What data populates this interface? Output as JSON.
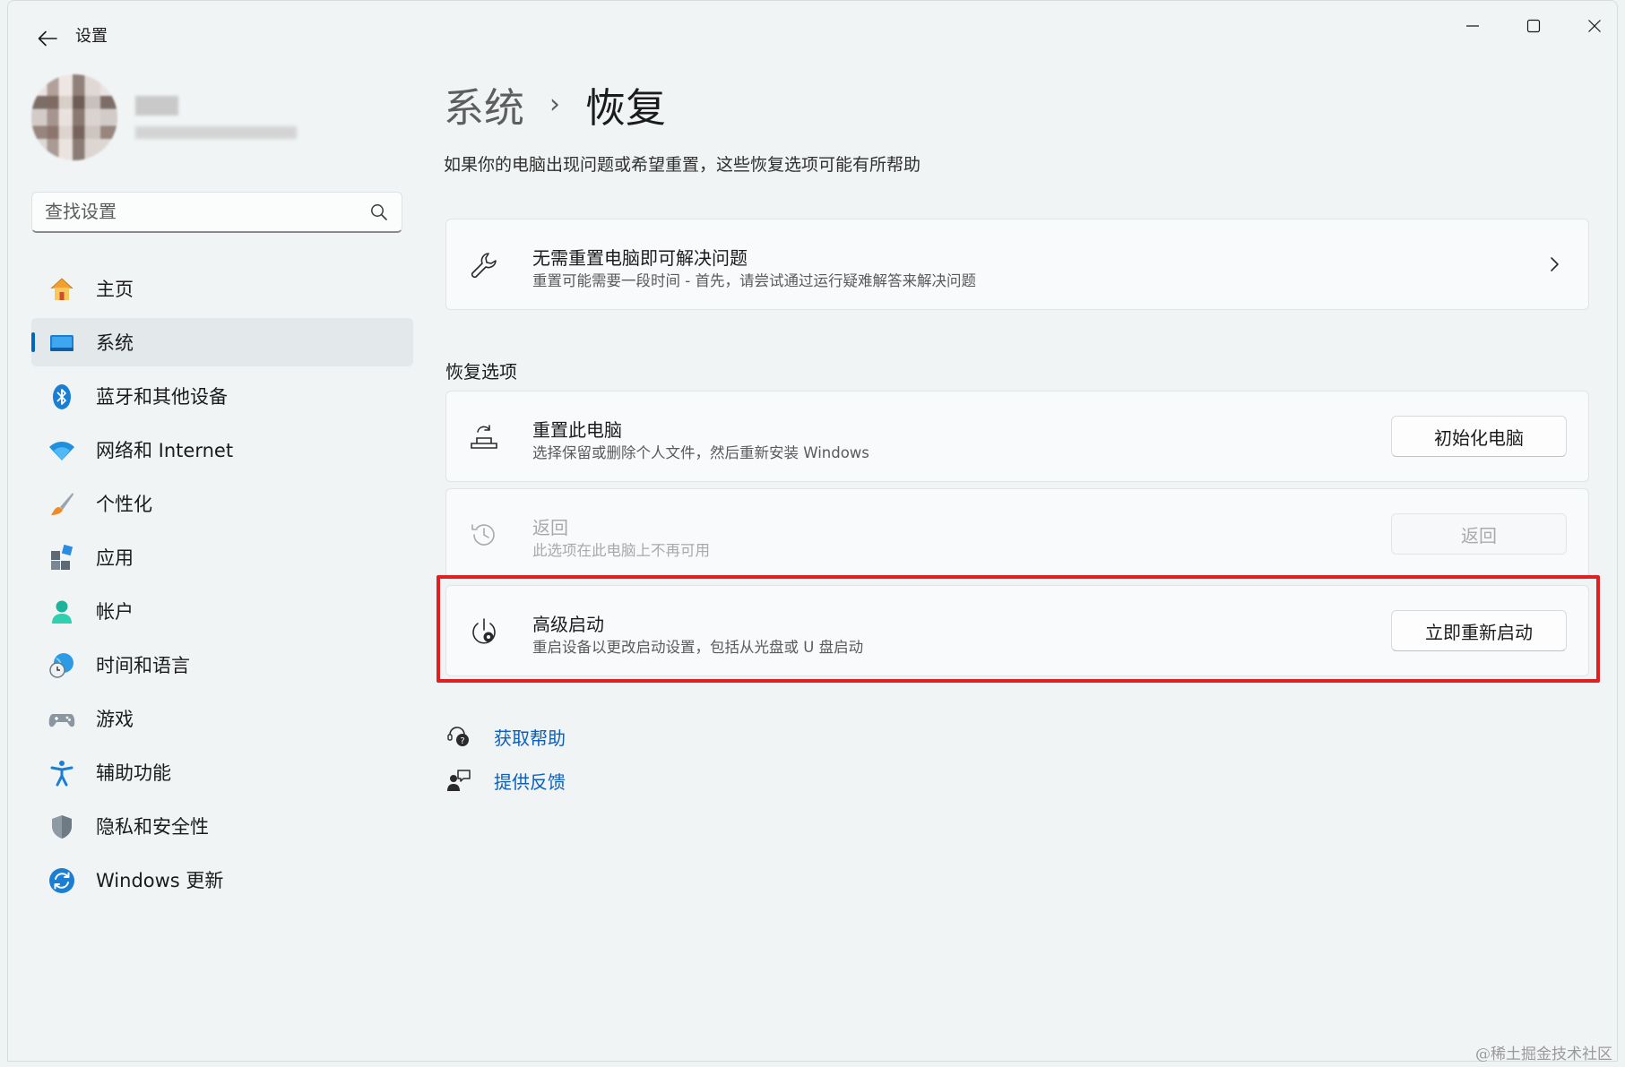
{
  "window": {
    "title": "设置"
  },
  "profile": {},
  "search": {
    "placeholder": "查找设置"
  },
  "nav": {
    "items": [
      {
        "label": "主页",
        "icon": "home-icon",
        "active": false
      },
      {
        "label": "系统",
        "icon": "system-monitor-icon",
        "active": true
      },
      {
        "label": "蓝牙和其他设备",
        "icon": "bluetooth-icon",
        "active": false
      },
      {
        "label": "网络和 Internet",
        "icon": "wifi-icon",
        "active": false
      },
      {
        "label": "个性化",
        "icon": "brush-icon",
        "active": false
      },
      {
        "label": "应用",
        "icon": "apps-icon",
        "active": false
      },
      {
        "label": "帐户",
        "icon": "account-icon",
        "active": false
      },
      {
        "label": "时间和语言",
        "icon": "globe-clock-icon",
        "active": false
      },
      {
        "label": "游戏",
        "icon": "gamepad-icon",
        "active": false
      },
      {
        "label": "辅助功能",
        "icon": "accessibility-icon",
        "active": false
      },
      {
        "label": "隐私和安全性",
        "icon": "shield-icon",
        "active": false
      },
      {
        "label": "Windows 更新",
        "icon": "update-icon",
        "active": false
      }
    ]
  },
  "breadcrumb": {
    "parent": "系统",
    "separator": "›",
    "current": "恢复"
  },
  "subtitle": "如果你的电脑出现问题或希望重置，这些恢复选项可能有所帮助",
  "fix_card": {
    "title": "无需重置电脑即可解决问题",
    "desc": "重置可能需要一段时间 - 首先，请尝试通过运行疑难解答来解决问题"
  },
  "section_title": "恢复选项",
  "options": [
    {
      "title": "重置此电脑",
      "desc": "选择保留或删除个人文件，然后重新安装 Windows",
      "button": "初始化电脑",
      "disabled": false
    },
    {
      "title": "返回",
      "desc": "此选项在此电脑上不再可用",
      "button": "返回",
      "disabled": true
    },
    {
      "title": "高级启动",
      "desc": "重启设备以更改启动设置，包括从光盘或 U 盘启动",
      "button": "立即重新启动",
      "disabled": false
    }
  ],
  "links": {
    "help": "获取帮助",
    "feedback": "提供反馈"
  },
  "watermark": "@稀土掘金技术社区",
  "colors": {
    "accent": "#0067c0",
    "link": "#0e5fb8",
    "highlight_border": "#e02020"
  }
}
